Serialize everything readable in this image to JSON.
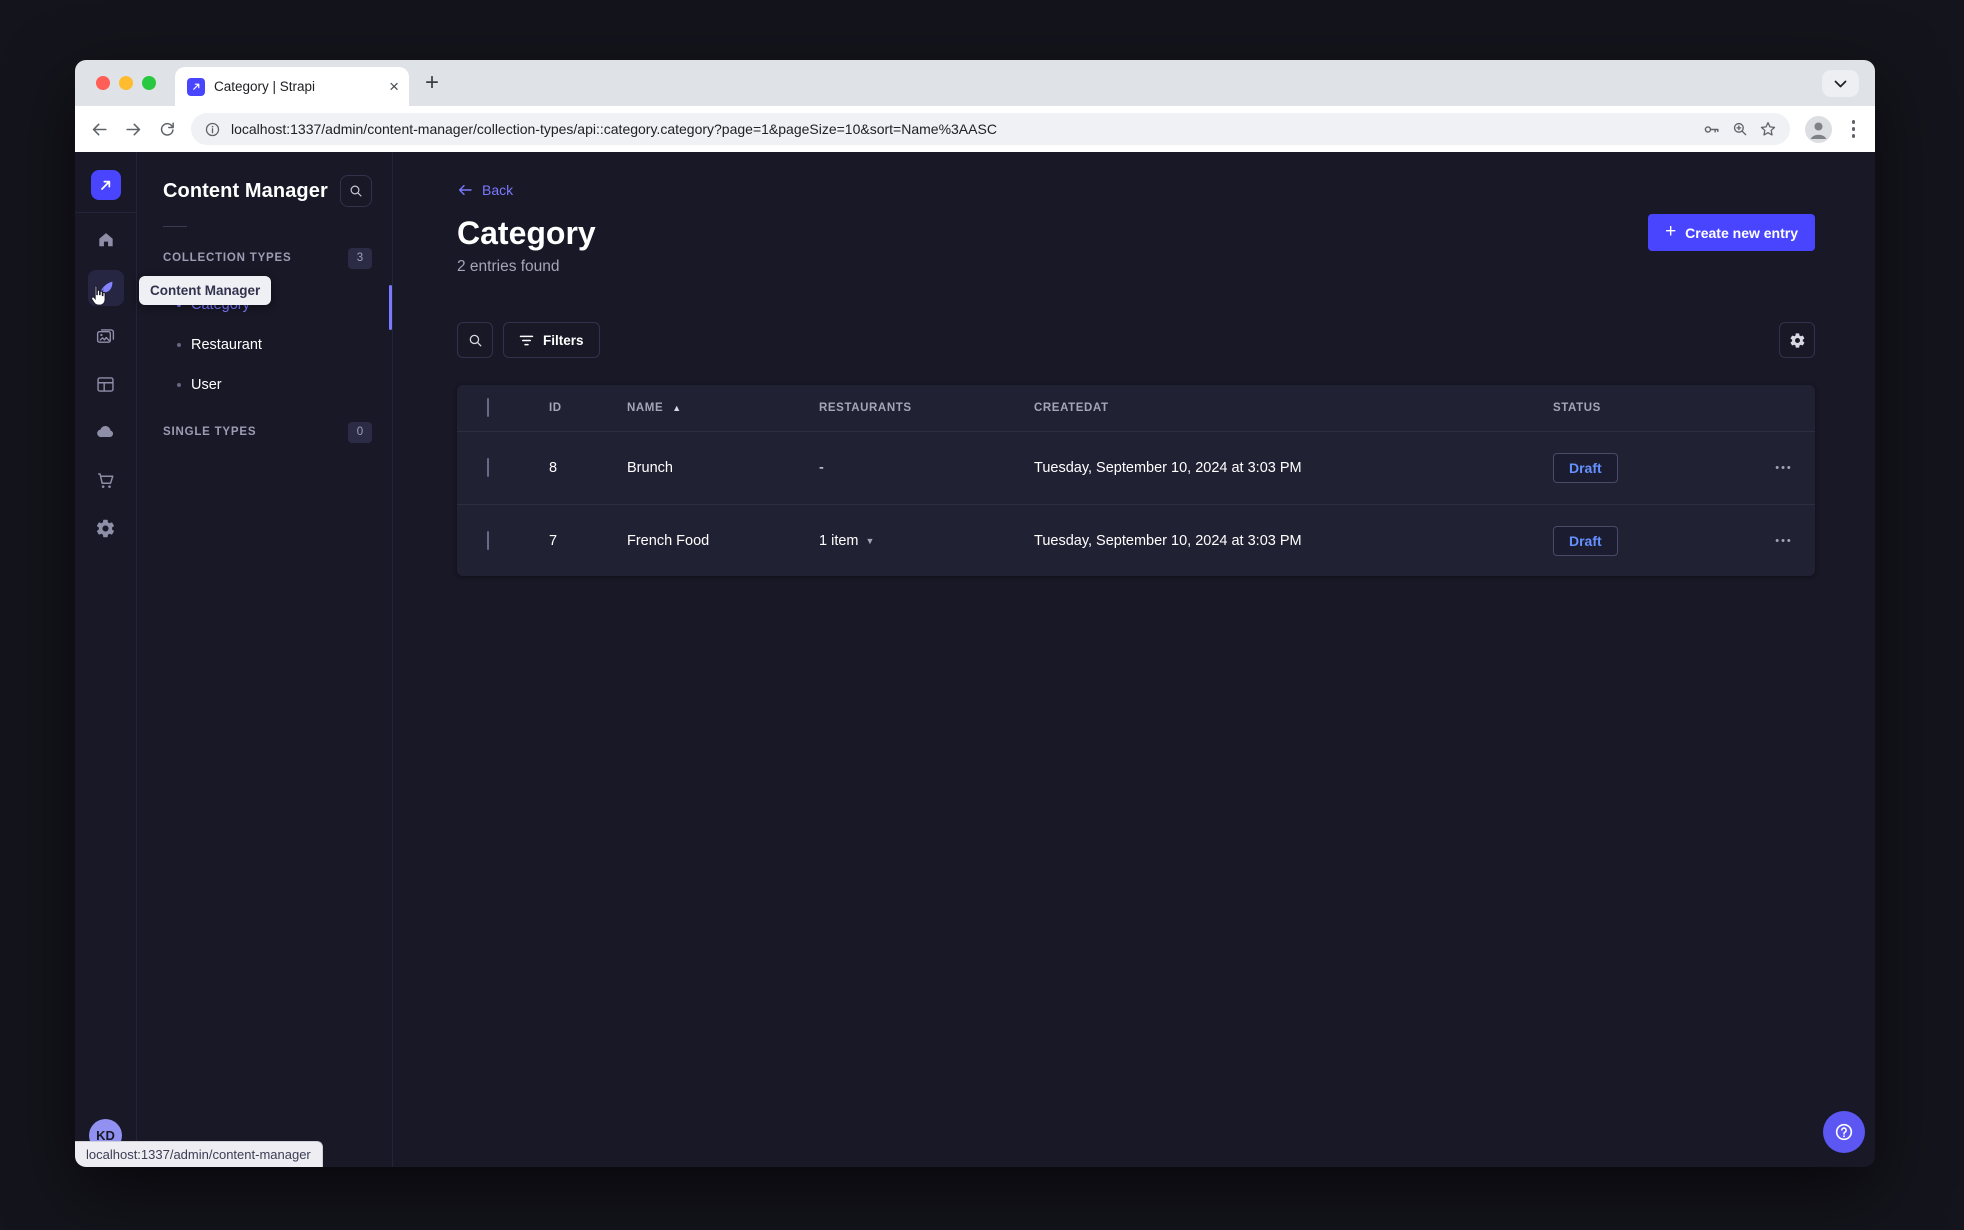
{
  "browser": {
    "tab": {
      "title": "Category | Strapi"
    },
    "url": "localhost:1337/admin/content-manager/collection-types/api::category.category?page=1&pageSize=10&sort=Name%3AASC",
    "status_link": "localhost:1337/admin/content-manager"
  },
  "icons": {
    "plus": "+",
    "close": "×",
    "more": "•••",
    "sort_asc": "▲",
    "caret_down": "▼"
  },
  "rail": {
    "tooltip": "Content Manager",
    "avatar_initials": "KD"
  },
  "subnav": {
    "title": "Content Manager",
    "collection_types": {
      "label": "COLLECTION TYPES",
      "count": "3",
      "items": [
        {
          "label": "Category",
          "active": true
        },
        {
          "label": "Restaurant",
          "active": false
        },
        {
          "label": "User",
          "active": false
        }
      ]
    },
    "single_types": {
      "label": "SINGLE TYPES",
      "count": "0"
    }
  },
  "main": {
    "back": "Back",
    "title": "Category",
    "subtitle": "2 entries found",
    "create_button": "Create new entry",
    "filters_button": "Filters",
    "table": {
      "headers": {
        "id": "ID",
        "name": "NAME",
        "restaurants": "RESTAURANTS",
        "createdat": "CREATEDAT",
        "status": "STATUS"
      },
      "rows": [
        {
          "id": "8",
          "name": "Brunch",
          "restaurants": "-",
          "createdat": "Tuesday, September 10, 2024 at 3:03 PM",
          "status": "Draft"
        },
        {
          "id": "7",
          "name": "French Food",
          "restaurants": "1 item",
          "createdat": "Tuesday, September 10, 2024 at 3:03 PM",
          "status": "Draft"
        }
      ]
    }
  },
  "colors": {
    "primary": "#4945ff",
    "accent_text": "#7b79ff",
    "draft_text": "#6590ff",
    "bg": "#181826",
    "card": "#212134"
  }
}
